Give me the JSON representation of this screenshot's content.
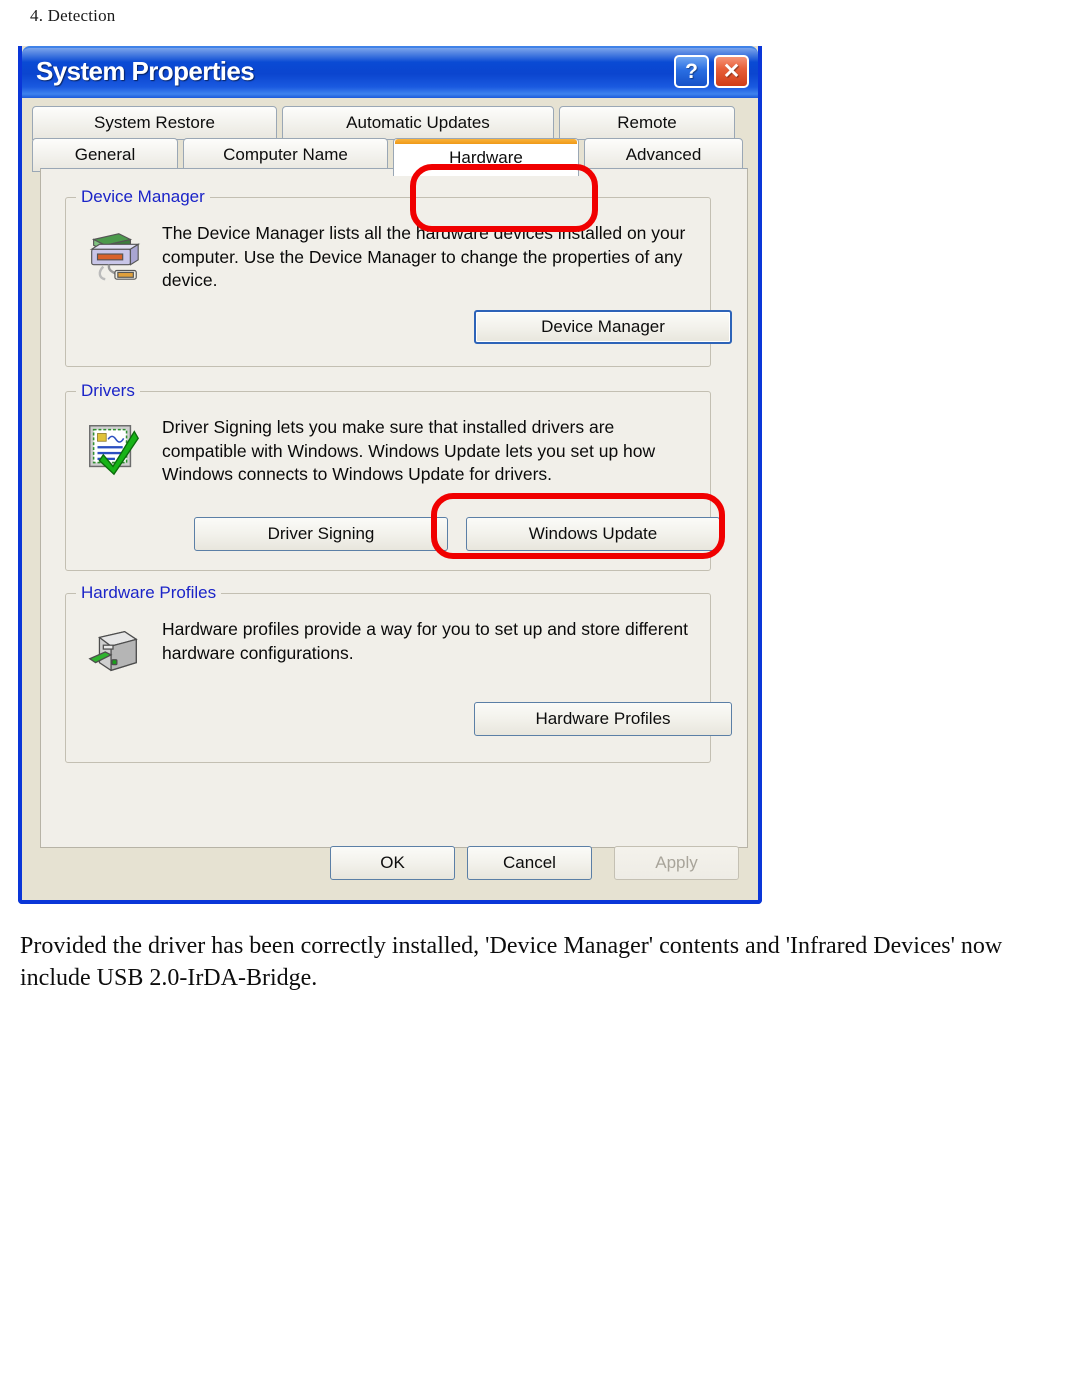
{
  "page": {
    "header": "4. Detection",
    "body_text": "Provided the driver has been correctly installed, 'Device Manager' contents and 'Infrared Devices' now include USB 2.0-IrDA-Bridge."
  },
  "dialog": {
    "title": "System Properties",
    "help_button": "?",
    "close_button": "✕",
    "accent_blue": "#0a36d8",
    "titlebar_blue": "#0b45cf",
    "surface": "#e6e2d2",
    "page_surface": "#f1efe9",
    "group_label_color": "#1b24c8",
    "annotation_color": "#f00000",
    "selected_tab_accent": "#ef9a18"
  },
  "tabs": {
    "row1": [
      {
        "label": "System Restore",
        "selected": false
      },
      {
        "label": "Automatic Updates",
        "selected": false
      },
      {
        "label": "Remote",
        "selected": false
      }
    ],
    "row2": [
      {
        "label": "General",
        "selected": false
      },
      {
        "label": "Computer Name",
        "selected": false
      },
      {
        "label": "Hardware",
        "selected": true
      },
      {
        "label": "Advanced",
        "selected": false
      }
    ]
  },
  "groups": {
    "device_manager": {
      "title": "Device Manager",
      "icon": "device-manager-icon",
      "description": "The Device Manager lists all the hardware devices installed on your computer. Use the Device Manager to change the properties of any device.",
      "button": "Device Manager"
    },
    "drivers": {
      "title": "Drivers",
      "icon": "driver-signing-certificate-icon",
      "description": "Driver Signing lets you make sure that installed drivers are compatible with Windows. Windows Update lets you set up how Windows connects to Windows Update for drivers.",
      "button_driver_signing": "Driver Signing",
      "button_windows_update": "Windows Update"
    },
    "hardware_profiles": {
      "title": "Hardware Profiles",
      "icon": "hardware-profile-case-icon",
      "description": "Hardware profiles provide a way for you to set up and store different hardware configurations.",
      "button": "Hardware Profiles"
    }
  },
  "footer": {
    "ok": "OK",
    "cancel": "Cancel",
    "apply": "Apply",
    "apply_disabled": true
  }
}
